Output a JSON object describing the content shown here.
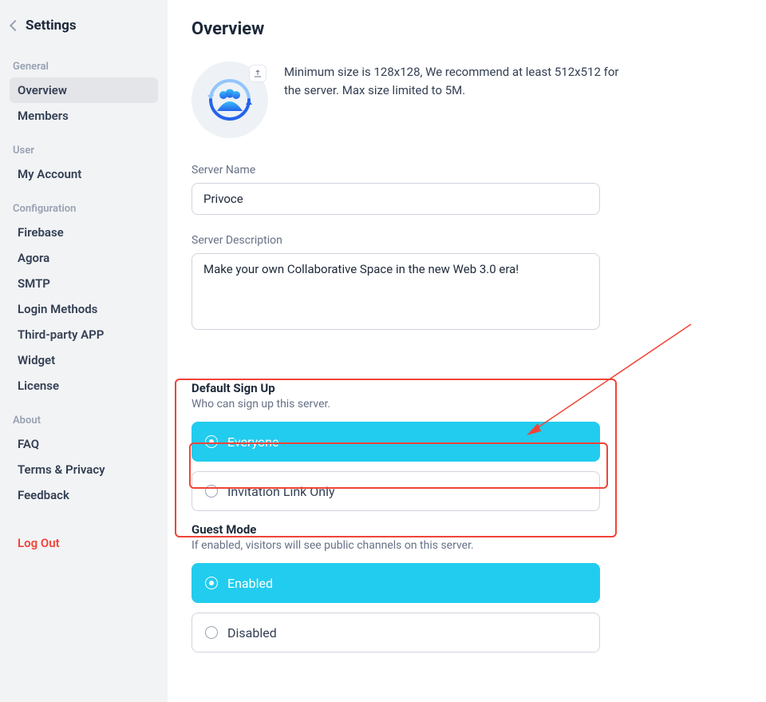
{
  "sidebar": {
    "title": "Settings",
    "sections": {
      "general": {
        "header": "General",
        "items": [
          "Overview",
          "Members"
        ]
      },
      "user": {
        "header": "User",
        "items": [
          "My Account"
        ]
      },
      "configuration": {
        "header": "Configuration",
        "items": [
          "Firebase",
          "Agora",
          "SMTP",
          "Login Methods",
          "Third-party APP",
          "Widget",
          "License"
        ]
      },
      "about": {
        "header": "About",
        "items": [
          "FAQ",
          "Terms & Privacy",
          "Feedback"
        ]
      }
    },
    "logout": "Log Out",
    "active": "Overview"
  },
  "main": {
    "page_title": "Overview",
    "avatar_hint": "Minimum size is 128x128, We recommend at least 512x512 for the server. Max size limited to 5M.",
    "server_name": {
      "label": "Server Name",
      "value": "Privoce"
    },
    "server_description": {
      "label": "Server Description",
      "value": "Make your own Collaborative Space in the new Web 3.0 era!"
    },
    "default_signup": {
      "title": "Default Sign Up",
      "subtitle": "Who can sign up this server.",
      "options": [
        "Everyone",
        "Invitation Link Only"
      ],
      "selected": "Everyone"
    },
    "guest_mode": {
      "title": "Guest Mode",
      "subtitle": "If enabled, visitors will see public channels on this server.",
      "options": [
        "Enabled",
        "Disabled"
      ],
      "selected": "Enabled"
    }
  },
  "annotation": {
    "box_color": "#f04438",
    "arrow_color": "#f04438"
  }
}
